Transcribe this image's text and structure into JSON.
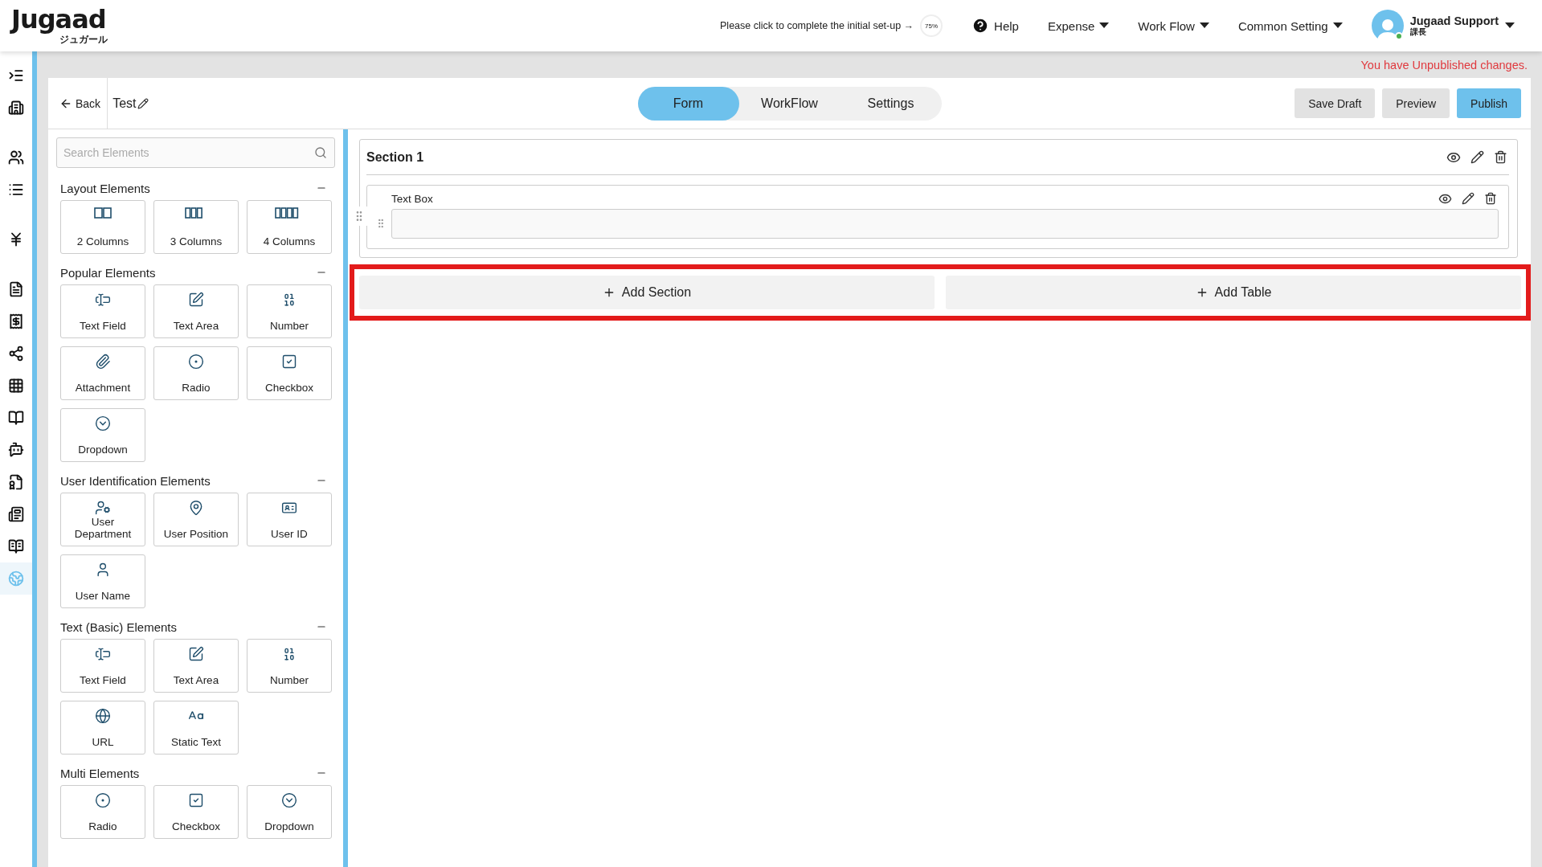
{
  "header": {
    "logo": "Jugaad",
    "logo_sub": "ジュガール",
    "setup_prompt": "Please click to complete the initial set-up →",
    "setup_progress": "75%",
    "nav": [
      {
        "label": "Help",
        "kind": "help"
      },
      {
        "label": "Expense",
        "kind": "menu"
      },
      {
        "label": "Work Flow",
        "kind": "menu"
      },
      {
        "label": "Common Setting",
        "kind": "menu"
      }
    ],
    "user": {
      "name": "Jugaad Support",
      "role": "課長",
      "online": true
    }
  },
  "sidebar": {
    "items": [
      {
        "selected": false
      },
      {
        "selected": false
      },
      {
        "selected": false
      },
      {
        "selected": false
      },
      {
        "selected": false
      },
      {
        "selected": false
      },
      {
        "selected": false
      },
      {
        "selected": false
      },
      {
        "selected": false
      },
      {
        "selected": false
      },
      {
        "selected": false
      },
      {
        "selected": false
      },
      {
        "selected": false
      },
      {
        "selected": false
      },
      {
        "selected": true
      }
    ]
  },
  "notice": "You have Unpublished changes.",
  "toolbar": {
    "back": "Back",
    "title": "Test",
    "tabs": [
      {
        "label": "Form",
        "selected": true
      },
      {
        "label": "WorkFlow",
        "selected": false
      },
      {
        "label": "Settings",
        "selected": false
      }
    ],
    "actions": [
      {
        "label": "Save Draft",
        "kind": "secondary"
      },
      {
        "label": "Preview",
        "kind": "secondary"
      },
      {
        "label": "Publish",
        "kind": "primary"
      }
    ]
  },
  "palette": {
    "search": {
      "placeholder": "Search Elements"
    },
    "groups": [
      {
        "title": "Layout Elements",
        "expanded": true,
        "items": [
          {
            "label": "2 Columns",
            "kind": "col2"
          },
          {
            "label": "3 Columns",
            "kind": "col3"
          },
          {
            "label": "4 Columns",
            "kind": "col4"
          }
        ]
      },
      {
        "title": "Popular Elements",
        "expanded": true,
        "items": [
          {
            "label": "Text Field",
            "kind": "textfield"
          },
          {
            "label": "Text Area",
            "kind": "textarea"
          },
          {
            "label": "Number",
            "kind": "number"
          },
          {
            "label": "Attachment",
            "kind": "attachment"
          },
          {
            "label": "Radio",
            "kind": "radio"
          },
          {
            "label": "Checkbox",
            "kind": "checkbox"
          },
          {
            "label": "Dropdown",
            "kind": "dropdown"
          }
        ]
      },
      {
        "title": "User Identification Elements",
        "expanded": true,
        "items": [
          {
            "label": "User Department",
            "kind": "department"
          },
          {
            "label": "User Position",
            "kind": "position"
          },
          {
            "label": "User ID",
            "kind": "userid"
          },
          {
            "label": "User Name",
            "kind": "username"
          }
        ]
      },
      {
        "title": "Text (Basic) Elements",
        "expanded": true,
        "items": [
          {
            "label": "Text Field",
            "kind": "textfield"
          },
          {
            "label": "Text Area",
            "kind": "textarea"
          },
          {
            "label": "Number",
            "kind": "number"
          },
          {
            "label": "URL",
            "kind": "url"
          },
          {
            "label": "Static Text",
            "kind": "static"
          }
        ]
      },
      {
        "title": "Multi Elements",
        "expanded": true,
        "items": [
          {
            "label": "Radio",
            "kind": "radio"
          },
          {
            "label": "Checkbox",
            "kind": "checkbox"
          },
          {
            "label": "Dropdown",
            "kind": "dropdown"
          }
        ]
      }
    ]
  },
  "canvas": {
    "section": {
      "title": "Section 1",
      "fields": [
        {
          "label": "Text Box"
        }
      ]
    },
    "add_buttons": [
      {
        "label": "Add Section"
      },
      {
        "label": "Add Table"
      }
    ],
    "highlighted": true
  }
}
